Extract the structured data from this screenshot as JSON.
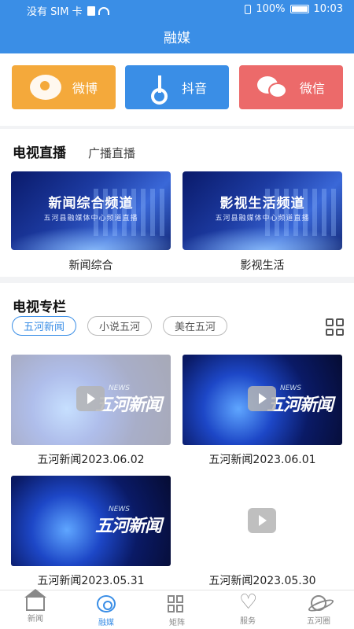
{
  "status_bar": {
    "carrier": "没有 SIM 卡",
    "battery": "100%",
    "time": "10:03"
  },
  "header": {
    "title": "融媒"
  },
  "social": {
    "weibo": {
      "label": "微博",
      "icon": "weibo-icon"
    },
    "douyin": {
      "label": "抖音",
      "icon": "tiktok-icon"
    },
    "wechat": {
      "label": "微信",
      "icon": "wechat-icon"
    }
  },
  "live": {
    "tab_tv": "电视直播",
    "tab_radio": "广播直播",
    "channels": [
      {
        "banner_title": "新闻综合频道",
        "banner_subtitle": "五河县融媒体中心频道直播",
        "label": "新闻综合"
      },
      {
        "banner_title": "影视生活频道",
        "banner_subtitle": "五河县融媒体中心频道直播",
        "label": "影视生活"
      }
    ]
  },
  "column": {
    "title": "电视专栏",
    "pills": [
      "五河新闻",
      "小说五河",
      "美在五河"
    ],
    "videos": [
      {
        "title": "五河新闻2023.06.02",
        "brand": "五河新闻",
        "brand_en": "NEWS"
      },
      {
        "title": "五河新闻2023.06.01",
        "brand": "五河新闻",
        "brand_en": "NEWS"
      },
      {
        "title": "五河新闻2023.05.31",
        "brand": "五河新闻",
        "brand_en": "NEWS"
      },
      {
        "title": "五河新闻2023.05.30"
      }
    ]
  },
  "nav": {
    "items": [
      {
        "label": "新闻",
        "icon": "home-icon"
      },
      {
        "label": "融媒",
        "icon": "media-icon",
        "active": true
      },
      {
        "label": "矩阵",
        "icon": "matrix-icon"
      },
      {
        "label": "服务",
        "icon": "heart-icon"
      },
      {
        "label": "五河圈",
        "icon": "planet-icon"
      }
    ]
  },
  "colors": {
    "primary": "#3a8ee6",
    "weibo": "#f4a93b",
    "wechat": "#ec6a6a"
  }
}
